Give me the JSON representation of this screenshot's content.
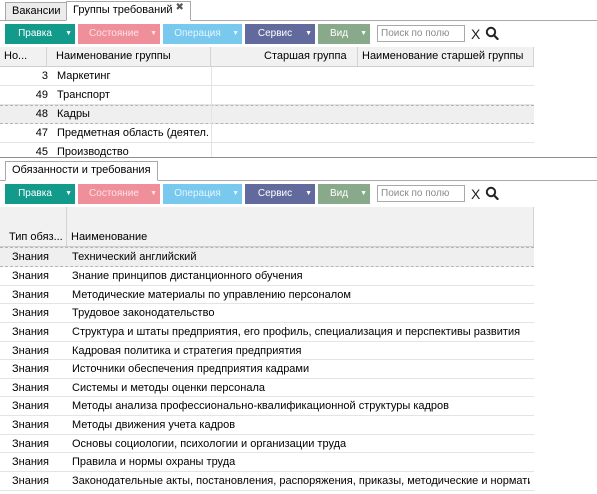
{
  "tabs": {
    "vacancies": "Вакансии",
    "groups": "Группы требований",
    "close_glyph": "✖"
  },
  "toolbar": {
    "edit": "Правка",
    "state": "Состояние",
    "operation": "Операция",
    "service": "Сервис",
    "view": "Вид",
    "dropdown_glyph": "▼",
    "search_placeholder": "Поиск по полю",
    "clear": "X"
  },
  "top_table": {
    "columns": {
      "num": "Но...",
      "name": "Наименование группы",
      "parent": "Старшая группа",
      "parent_name": "Наименование старшей группы"
    },
    "rows": [
      {
        "num": "3",
        "name": "Маркетинг"
      },
      {
        "num": "49",
        "name": "Транспорт"
      },
      {
        "num": "48",
        "name": "Кадры"
      },
      {
        "num": "47",
        "name": "Предметная область (деятел..."
      },
      {
        "num": "45",
        "name": "Производство"
      }
    ]
  },
  "bottom_tab": "Обязанности и требования",
  "bottom_table": {
    "columns": {
      "type": "Тип обяз...",
      "name": "Наименование"
    },
    "rows": [
      {
        "type": "Знания",
        "name": "Технический английский"
      },
      {
        "type": "Знания",
        "name": "Знание принципов дистанционного обучения"
      },
      {
        "type": "Знания",
        "name": "Методические материалы по управлению персоналом"
      },
      {
        "type": "Знания",
        "name": "Трудовое законодательство"
      },
      {
        "type": "Знания",
        "name": "Структура и штаты предприятия, его профиль, специализация и перспективы развития"
      },
      {
        "type": "Знания",
        "name": "Кадровая политика и стратегия предприятия"
      },
      {
        "type": "Знания",
        "name": "Источники обеспечения предприятия кадрами"
      },
      {
        "type": "Знания",
        "name": "Системы и методы оценки персонала"
      },
      {
        "type": "Знания",
        "name": "Методы анализа профессионально-квалификационной структуры кадров"
      },
      {
        "type": "Знания",
        "name": "Методы движения учета кадров"
      },
      {
        "type": "Знания",
        "name": "Основы социологии, психологии и организации труда"
      },
      {
        "type": "Знания",
        "name": "Правила и нормы охраны труда"
      },
      {
        "type": "Знания",
        "name": "Законодательные акты, постановления, распоряжения, приказы, методические и нормативные..."
      }
    ]
  },
  "colors": {
    "edit": "#129a8b",
    "state": "#ef8f9a",
    "operation": "#79c9ef",
    "service": "#626a9d",
    "view": "#89a98b"
  }
}
